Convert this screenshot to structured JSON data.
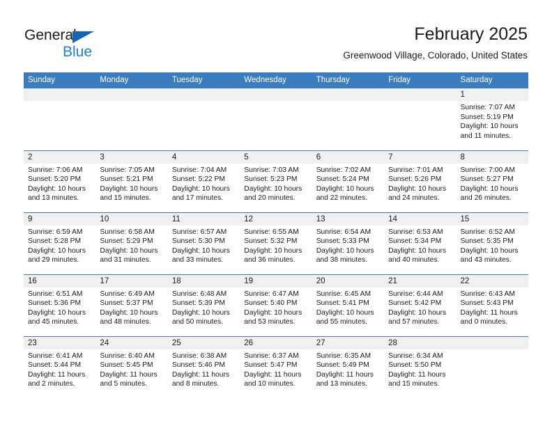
{
  "brand": {
    "line1": "General",
    "line2": "Blue",
    "logo_icon": "triangle-flag-icon",
    "accent_color": "#1f7fd0",
    "triangle_color": "#1565b0"
  },
  "header": {
    "title": "February 2025",
    "location": "Greenwood Village, Colorado, United States"
  },
  "theme": {
    "header_row_bg": "#3a7cbe",
    "daynum_bg": "#f0f0f0",
    "grid_line": "#3a7cbe",
    "text": "#1a1a1a"
  },
  "weekday_headers": [
    "Sunday",
    "Monday",
    "Tuesday",
    "Wednesday",
    "Thursday",
    "Friday",
    "Saturday"
  ],
  "weeks": [
    [
      {
        "day": "",
        "sunrise": "",
        "sunset": "",
        "daylight": "",
        "daylight2": ""
      },
      {
        "day": "",
        "sunrise": "",
        "sunset": "",
        "daylight": "",
        "daylight2": ""
      },
      {
        "day": "",
        "sunrise": "",
        "sunset": "",
        "daylight": "",
        "daylight2": ""
      },
      {
        "day": "",
        "sunrise": "",
        "sunset": "",
        "daylight": "",
        "daylight2": ""
      },
      {
        "day": "",
        "sunrise": "",
        "sunset": "",
        "daylight": "",
        "daylight2": ""
      },
      {
        "day": "",
        "sunrise": "",
        "sunset": "",
        "daylight": "",
        "daylight2": ""
      },
      {
        "day": "1",
        "sunrise": "Sunrise: 7:07 AM",
        "sunset": "Sunset: 5:19 PM",
        "daylight": "Daylight: 10 hours",
        "daylight2": "and 11 minutes."
      }
    ],
    [
      {
        "day": "2",
        "sunrise": "Sunrise: 7:06 AM",
        "sunset": "Sunset: 5:20 PM",
        "daylight": "Daylight: 10 hours",
        "daylight2": "and 13 minutes."
      },
      {
        "day": "3",
        "sunrise": "Sunrise: 7:05 AM",
        "sunset": "Sunset: 5:21 PM",
        "daylight": "Daylight: 10 hours",
        "daylight2": "and 15 minutes."
      },
      {
        "day": "4",
        "sunrise": "Sunrise: 7:04 AM",
        "sunset": "Sunset: 5:22 PM",
        "daylight": "Daylight: 10 hours",
        "daylight2": "and 17 minutes."
      },
      {
        "day": "5",
        "sunrise": "Sunrise: 7:03 AM",
        "sunset": "Sunset: 5:23 PM",
        "daylight": "Daylight: 10 hours",
        "daylight2": "and 20 minutes."
      },
      {
        "day": "6",
        "sunrise": "Sunrise: 7:02 AM",
        "sunset": "Sunset: 5:24 PM",
        "daylight": "Daylight: 10 hours",
        "daylight2": "and 22 minutes."
      },
      {
        "day": "7",
        "sunrise": "Sunrise: 7:01 AM",
        "sunset": "Sunset: 5:26 PM",
        "daylight": "Daylight: 10 hours",
        "daylight2": "and 24 minutes."
      },
      {
        "day": "8",
        "sunrise": "Sunrise: 7:00 AM",
        "sunset": "Sunset: 5:27 PM",
        "daylight": "Daylight: 10 hours",
        "daylight2": "and 26 minutes."
      }
    ],
    [
      {
        "day": "9",
        "sunrise": "Sunrise: 6:59 AM",
        "sunset": "Sunset: 5:28 PM",
        "daylight": "Daylight: 10 hours",
        "daylight2": "and 29 minutes."
      },
      {
        "day": "10",
        "sunrise": "Sunrise: 6:58 AM",
        "sunset": "Sunset: 5:29 PM",
        "daylight": "Daylight: 10 hours",
        "daylight2": "and 31 minutes."
      },
      {
        "day": "11",
        "sunrise": "Sunrise: 6:57 AM",
        "sunset": "Sunset: 5:30 PM",
        "daylight": "Daylight: 10 hours",
        "daylight2": "and 33 minutes."
      },
      {
        "day": "12",
        "sunrise": "Sunrise: 6:55 AM",
        "sunset": "Sunset: 5:32 PM",
        "daylight": "Daylight: 10 hours",
        "daylight2": "and 36 minutes."
      },
      {
        "day": "13",
        "sunrise": "Sunrise: 6:54 AM",
        "sunset": "Sunset: 5:33 PM",
        "daylight": "Daylight: 10 hours",
        "daylight2": "and 38 minutes."
      },
      {
        "day": "14",
        "sunrise": "Sunrise: 6:53 AM",
        "sunset": "Sunset: 5:34 PM",
        "daylight": "Daylight: 10 hours",
        "daylight2": "and 40 minutes."
      },
      {
        "day": "15",
        "sunrise": "Sunrise: 6:52 AM",
        "sunset": "Sunset: 5:35 PM",
        "daylight": "Daylight: 10 hours",
        "daylight2": "and 43 minutes."
      }
    ],
    [
      {
        "day": "16",
        "sunrise": "Sunrise: 6:51 AM",
        "sunset": "Sunset: 5:36 PM",
        "daylight": "Daylight: 10 hours",
        "daylight2": "and 45 minutes."
      },
      {
        "day": "17",
        "sunrise": "Sunrise: 6:49 AM",
        "sunset": "Sunset: 5:37 PM",
        "daylight": "Daylight: 10 hours",
        "daylight2": "and 48 minutes."
      },
      {
        "day": "18",
        "sunrise": "Sunrise: 6:48 AM",
        "sunset": "Sunset: 5:39 PM",
        "daylight": "Daylight: 10 hours",
        "daylight2": "and 50 minutes."
      },
      {
        "day": "19",
        "sunrise": "Sunrise: 6:47 AM",
        "sunset": "Sunset: 5:40 PM",
        "daylight": "Daylight: 10 hours",
        "daylight2": "and 53 minutes."
      },
      {
        "day": "20",
        "sunrise": "Sunrise: 6:45 AM",
        "sunset": "Sunset: 5:41 PM",
        "daylight": "Daylight: 10 hours",
        "daylight2": "and 55 minutes."
      },
      {
        "day": "21",
        "sunrise": "Sunrise: 6:44 AM",
        "sunset": "Sunset: 5:42 PM",
        "daylight": "Daylight: 10 hours",
        "daylight2": "and 57 minutes."
      },
      {
        "day": "22",
        "sunrise": "Sunrise: 6:43 AM",
        "sunset": "Sunset: 5:43 PM",
        "daylight": "Daylight: 11 hours",
        "daylight2": "and 0 minutes."
      }
    ],
    [
      {
        "day": "23",
        "sunrise": "Sunrise: 6:41 AM",
        "sunset": "Sunset: 5:44 PM",
        "daylight": "Daylight: 11 hours",
        "daylight2": "and 2 minutes."
      },
      {
        "day": "24",
        "sunrise": "Sunrise: 6:40 AM",
        "sunset": "Sunset: 5:45 PM",
        "daylight": "Daylight: 11 hours",
        "daylight2": "and 5 minutes."
      },
      {
        "day": "25",
        "sunrise": "Sunrise: 6:38 AM",
        "sunset": "Sunset: 5:46 PM",
        "daylight": "Daylight: 11 hours",
        "daylight2": "and 8 minutes."
      },
      {
        "day": "26",
        "sunrise": "Sunrise: 6:37 AM",
        "sunset": "Sunset: 5:47 PM",
        "daylight": "Daylight: 11 hours",
        "daylight2": "and 10 minutes."
      },
      {
        "day": "27",
        "sunrise": "Sunrise: 6:35 AM",
        "sunset": "Sunset: 5:49 PM",
        "daylight": "Daylight: 11 hours",
        "daylight2": "and 13 minutes."
      },
      {
        "day": "28",
        "sunrise": "Sunrise: 6:34 AM",
        "sunset": "Sunset: 5:50 PM",
        "daylight": "Daylight: 11 hours",
        "daylight2": "and 15 minutes."
      },
      {
        "day": "",
        "sunrise": "",
        "sunset": "",
        "daylight": "",
        "daylight2": ""
      }
    ]
  ]
}
